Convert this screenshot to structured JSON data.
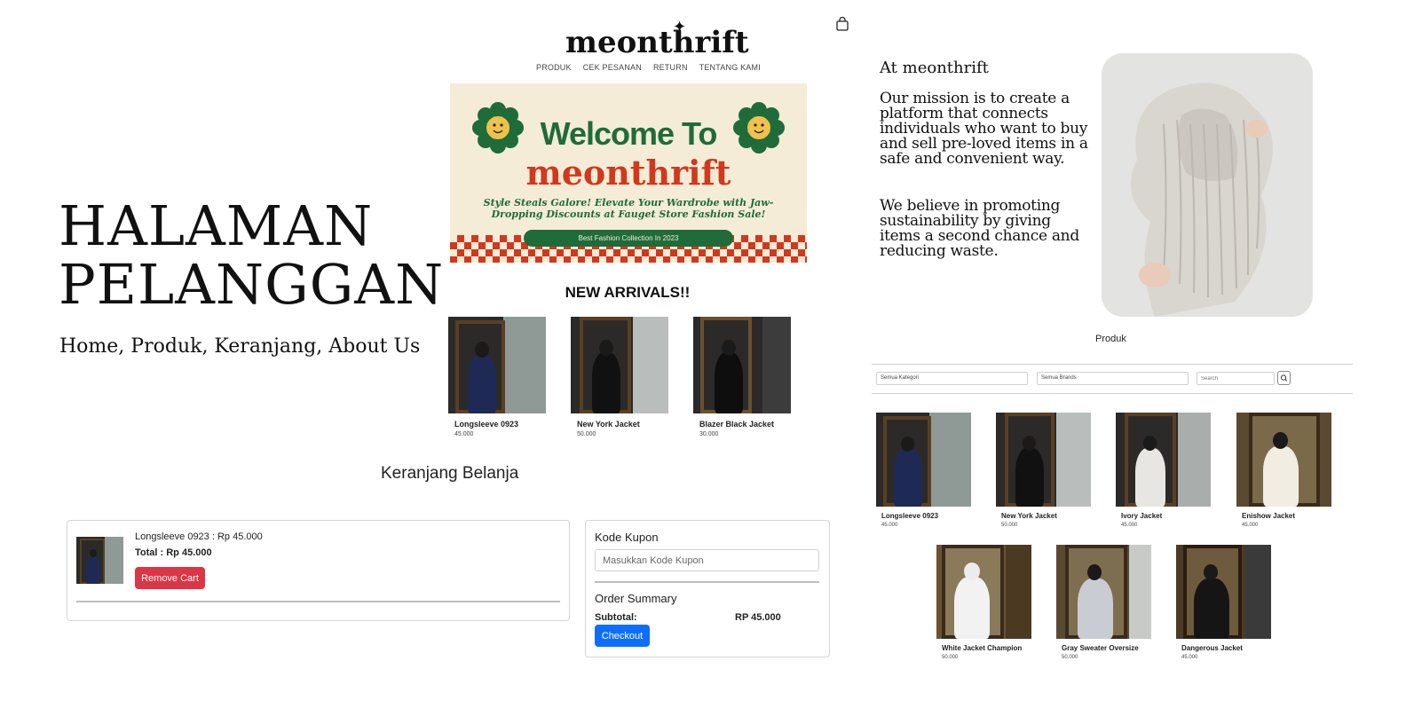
{
  "left_panel": {
    "title_line1": "HALAMAN",
    "title_line2": "PELANGGAN",
    "subtitle": "Home, Produk, Keranjang, About Us"
  },
  "header": {
    "logo": "meonthrift",
    "nav": [
      "PRODUK",
      "CEK PESANAN",
      "RETURN",
      "TENTANG KAMI"
    ],
    "cart_icon": "shopping-bag-icon"
  },
  "banner": {
    "welcome": "Welcome To",
    "brand": "meonthrift",
    "tagline": "Style Steals Galore! Elevate Your Wardrobe with Jaw-Dropping Discounts at Fauget Store Fashion Sale!",
    "pill": "Best Fashion Collection In 2023",
    "colors": {
      "green": "#1f6b3a",
      "red": "#d1381d",
      "cream": "#f4ecd6"
    }
  },
  "new_arrivals": {
    "title": "NEW ARRIVALS!!",
    "items": [
      {
        "name": "Longsleeve 0923",
        "price": "45.000"
      },
      {
        "name": "New York Jacket",
        "price": "50.000"
      },
      {
        "name": "Blazer Black Jacket",
        "price": "30.000"
      }
    ]
  },
  "cart": {
    "title": "Keranjang Belanja",
    "item_line": "Longsleeve 0923 : Rp 45.000",
    "total": "Total : Rp 45.000",
    "remove_label": "Remove Cart",
    "coupon_label": "Kode Kupon",
    "coupon_placeholder": "Masukkan Kode Kupon",
    "summary_title": "Order Summary",
    "subtotal_label": "Subtotal:",
    "subtotal_value": "RP 45.000",
    "checkout_label": "Checkout",
    "colors": {
      "remove": "#dc3545",
      "checkout": "#0d6efd"
    }
  },
  "about": {
    "heading": "At meonthrift",
    "p1": "Our mission is to create a platform that connects individuals who want to buy and sell pre-loved items in a safe and convenient way.",
    "p2": "We believe in promoting sustainability by giving items a second chance and reducing waste."
  },
  "produk": {
    "title": "Produk",
    "category_select": "Semua Kategori",
    "brand_select": "Semua Brands",
    "search_placeholder": "Search",
    "items": [
      {
        "name": "Longsleeve 0923",
        "price": "45.000"
      },
      {
        "name": "New York Jacket",
        "price": "50.000"
      },
      {
        "name": "Ivory Jacket",
        "price": "45.000"
      },
      {
        "name": "Enishow Jacket",
        "price": "45.000"
      },
      {
        "name": "White Jacket Champion",
        "price": "50.000"
      },
      {
        "name": "Gray Sweater Oversize",
        "price": "50.000"
      },
      {
        "name": "Dangerous Jacket",
        "price": "45.000"
      }
    ]
  }
}
